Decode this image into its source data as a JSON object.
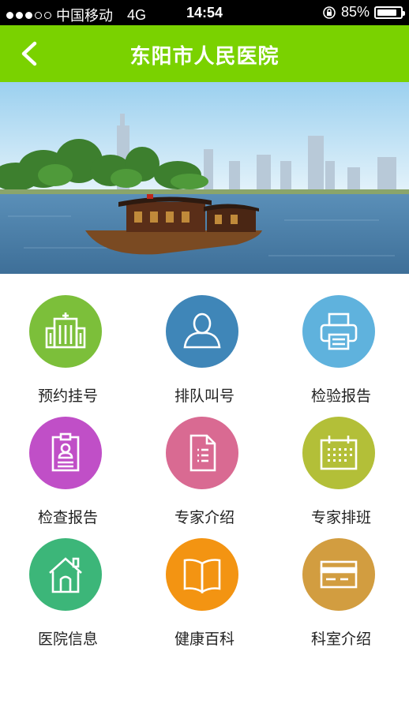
{
  "status_bar": {
    "carrier": "中国移动",
    "network": "4G",
    "time": "14:54",
    "battery": "85%",
    "battery_level": 0.85,
    "signal_bars_filled": 3,
    "signal_bars_total": 5
  },
  "header": {
    "title": "东阳市人民医院",
    "back_icon": "chevron-left-icon",
    "background": "#7ad200"
  },
  "menu": {
    "items": [
      {
        "label": "预约挂号",
        "icon": "hospital-building-icon",
        "color": "#7cbf3a"
      },
      {
        "label": "排队叫号",
        "icon": "person-icon",
        "color": "#3f86b8"
      },
      {
        "label": "检验报告",
        "icon": "printer-icon",
        "color": "#5fb2dd"
      },
      {
        "label": "检查报告",
        "icon": "clipboard-icon",
        "color": "#c04fc7"
      },
      {
        "label": "专家介绍",
        "icon": "document-icon",
        "color": "#d96a92"
      },
      {
        "label": "专家排班",
        "icon": "calendar-icon",
        "color": "#b3bf38"
      },
      {
        "label": "医院信息",
        "icon": "home-icon",
        "color": "#3cb679"
      },
      {
        "label": "健康百科",
        "icon": "book-icon",
        "color": "#f39412"
      },
      {
        "label": "科室介绍",
        "icon": "card-icon",
        "color": "#d29d40"
      }
    ]
  }
}
